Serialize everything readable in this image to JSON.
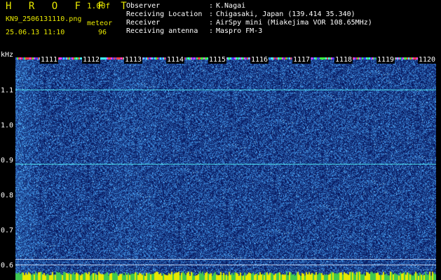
{
  "header": {
    "brand": "H R O F F T",
    "version": "1.00f",
    "filename": "KN9_2506131110.png",
    "timestamp": "25.06.13 11:10",
    "tag": "meteor",
    "count": "96"
  },
  "meta": [
    {
      "label": "Observer",
      "value": "K.Nagai"
    },
    {
      "label": "Receiving Location",
      "value": "Chigasaki, Japan (139.414 35.340)"
    },
    {
      "label": "Receiver",
      "value": "AirSpy mini (Miakejima VOR 108.65MHz)"
    },
    {
      "label": "Receiving antenna",
      "value": "Maspro FM-3"
    }
  ],
  "axis": {
    "unit": "kHz",
    "y_ticks": [
      "1.1",
      "1.0",
      "0.9",
      "0.8",
      "0.7",
      "0.6"
    ],
    "minute_labels": [
      "1111",
      "1112",
      "1113",
      "1114",
      "1115",
      "1116",
      "1117",
      "1118",
      "1119",
      "1120"
    ]
  },
  "colors": {
    "background": "#000000",
    "header_yellow": "#e8e800",
    "noise_dark": "#0a1a6e",
    "noise_light": "#4a7ac8",
    "carrier_line": "#4ad8e8",
    "ref_line": "#b8c8e8"
  }
}
